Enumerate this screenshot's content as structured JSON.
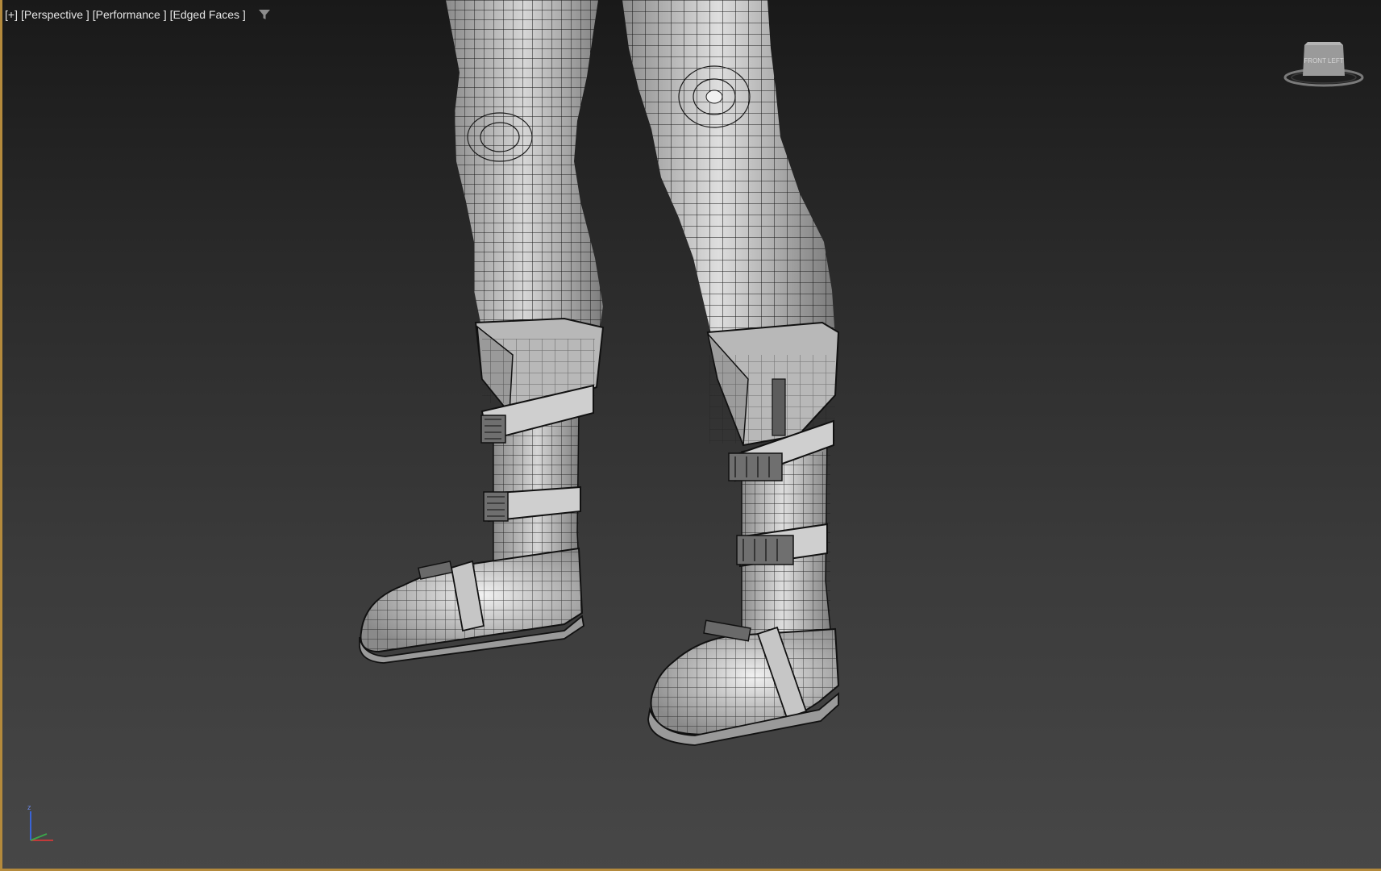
{
  "viewport": {
    "labels": {
      "plus": "[+]",
      "view": "[Perspective ]",
      "mode": "[Performance ]",
      "shading": "[Edged Faces ]"
    },
    "filter_icon": "filter-icon",
    "viewcube": {
      "icon": "viewcube-icon",
      "face_text": "FRONT  LEFT"
    },
    "axis_tripod": {
      "icon": "axis-tripod-icon",
      "z_label": "z"
    },
    "border_color": "#b48a3c",
    "model": "character-legs-with-boots-wireframe"
  }
}
